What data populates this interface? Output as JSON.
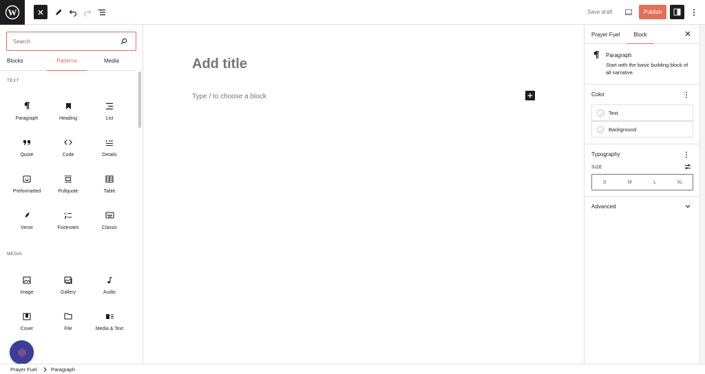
{
  "colors": {
    "accent": "#e26f56",
    "dark": "#1e1e1e",
    "muted": "#757575",
    "help": "#3a3d99"
  },
  "toolbar": {
    "save_draft": "Save draft",
    "publish": "Publish"
  },
  "inserter": {
    "search_placeholder": "Search",
    "tabs": [
      "Blocks",
      "Patterns",
      "Media"
    ],
    "active_tab": "Patterns",
    "categories": [
      {
        "title": "TEXT",
        "blocks": [
          "Paragraph",
          "Heading",
          "List",
          "Quote",
          "Code",
          "Details",
          "Preformatted",
          "Pullquote",
          "Table",
          "Verse",
          "Footnotes",
          "Classic"
        ]
      },
      {
        "title": "MEDIA",
        "blocks": [
          "Image",
          "Gallery",
          "Audio",
          "Cover",
          "File",
          "Media & Text"
        ]
      }
    ]
  },
  "canvas": {
    "title_placeholder": "Add title",
    "block_placeholder": "Type / to choose a block"
  },
  "sidebar": {
    "tabs": [
      "Prayer Fuel",
      "Block"
    ],
    "active_tab": "Block",
    "block_name": "Paragraph",
    "block_description": "Start with the basic building block of all narrative.",
    "color": {
      "title": "Color",
      "items": [
        "Text",
        "Background"
      ]
    },
    "typography": {
      "title": "Typography",
      "size_label": "SIZE",
      "sizes": [
        "S",
        "M",
        "L",
        "XL"
      ]
    },
    "advanced": "Advanced"
  },
  "breadcrumb": [
    "Prayer Fuel",
    "Paragraph"
  ]
}
